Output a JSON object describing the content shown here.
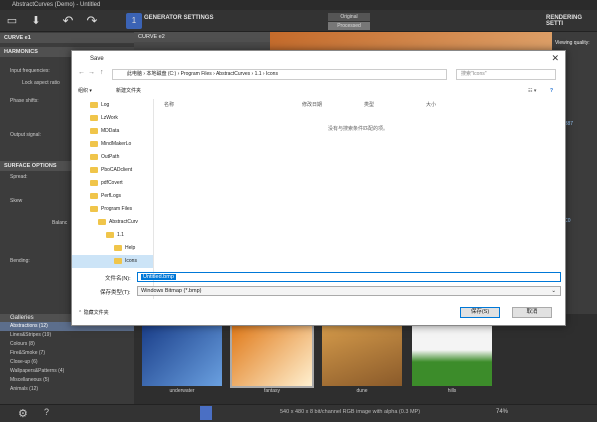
{
  "app": {
    "title": "AbstractCurves (Demo) - Untitled",
    "toolbar": {
      "generator_settings": "GENERATOR SETTINGS",
      "rendering_settings": "RENDERING SETTI",
      "mode_original": "Original",
      "mode_processed": "Processed",
      "num_badge": "1"
    },
    "left_panel": {
      "curve_tab": "CURVE e1",
      "harmonics": "HARMONICS",
      "input_frequencies": "Input frequencies:",
      "lock_aspect": "Lock aspect ratio",
      "phase_shifts": "Phase shifts:",
      "output_signal": "Output signal:",
      "surface_options": "SURFACE OPTIONS",
      "spread": "Spread:",
      "skew": "Skew",
      "balance": "Balanc",
      "bending": "Bending:"
    },
    "mid_panel": {
      "curve_tab": "CURVE e2"
    },
    "right_panel": {
      "viewing_quality": "Viewing quality:",
      "hex1": "DE8887",
      "hex2": "9C3C0"
    },
    "galleries": {
      "title": "Galleries",
      "items": [
        {
          "label": "Abstractions (12)",
          "selected": true
        },
        {
          "label": "Lines&Stripes (19)",
          "selected": false
        },
        {
          "label": "Colours (8)",
          "selected": false
        },
        {
          "label": "Fire&Smoke (7)",
          "selected": false
        },
        {
          "label": "Close-up (6)",
          "selected": false
        },
        {
          "label": "Wallpapers&Patterns (4)",
          "selected": false
        },
        {
          "label": "Miscellaneous (5)",
          "selected": false
        },
        {
          "label": "Animals (12)",
          "selected": false
        }
      ]
    },
    "thumbnails": [
      {
        "label": "underwater"
      },
      {
        "label": "fantasy"
      },
      {
        "label": "dune"
      },
      {
        "label": "hills"
      }
    ],
    "status": {
      "image_info": "540 x 480 x 8 bit/channel RGB image with alpha  (0.3 MP)",
      "zoom": "74%"
    }
  },
  "dialog": {
    "title": "Save",
    "breadcrumb": [
      "此电脑",
      "本地磁盘 (C:)",
      "Program Files",
      "AbstractCurves",
      "1.1",
      "Icons"
    ],
    "search_placeholder": "搜索\"Icons\"",
    "organize": "组织 ▾",
    "new_folder": "新建文件夹",
    "columns": [
      "名称",
      "修改日期",
      "类型",
      "大小"
    ],
    "empty_message": "没有与搜索条件匹配的项。",
    "tree": [
      {
        "label": "Log",
        "indent": 0,
        "selected": false
      },
      {
        "label": "LzWork",
        "indent": 0,
        "selected": false
      },
      {
        "label": "MDData",
        "indent": 0,
        "selected": false
      },
      {
        "label": "MindMakerLo",
        "indent": 0,
        "selected": false
      },
      {
        "label": "OutPath",
        "indent": 0,
        "selected": false
      },
      {
        "label": "PboCADclient",
        "indent": 0,
        "selected": false
      },
      {
        "label": "pdfCovert",
        "indent": 0,
        "selected": false
      },
      {
        "label": "PerfLogs",
        "indent": 0,
        "selected": false
      },
      {
        "label": "Program Files",
        "indent": 0,
        "selected": false
      },
      {
        "label": "AbstractCurv",
        "indent": 1,
        "selected": false
      },
      {
        "label": "1.1",
        "indent": 2,
        "selected": false
      },
      {
        "label": "Help",
        "indent": 3,
        "selected": false
      },
      {
        "label": "Icons",
        "indent": 3,
        "selected": true
      }
    ],
    "filename_label": "文件名(N):",
    "filename_value": "Untitled.bmp",
    "filetype_label": "保存类型(T):",
    "filetype_value": "Windows Bitmap (*.bmp)",
    "hide_folders": "隐藏文件夹",
    "save_button": "保存(S)",
    "cancel_button": "取消"
  },
  "colors": {
    "accent": "#0078d7",
    "selection": "#cce4f7",
    "folder": "#f0c54a"
  }
}
